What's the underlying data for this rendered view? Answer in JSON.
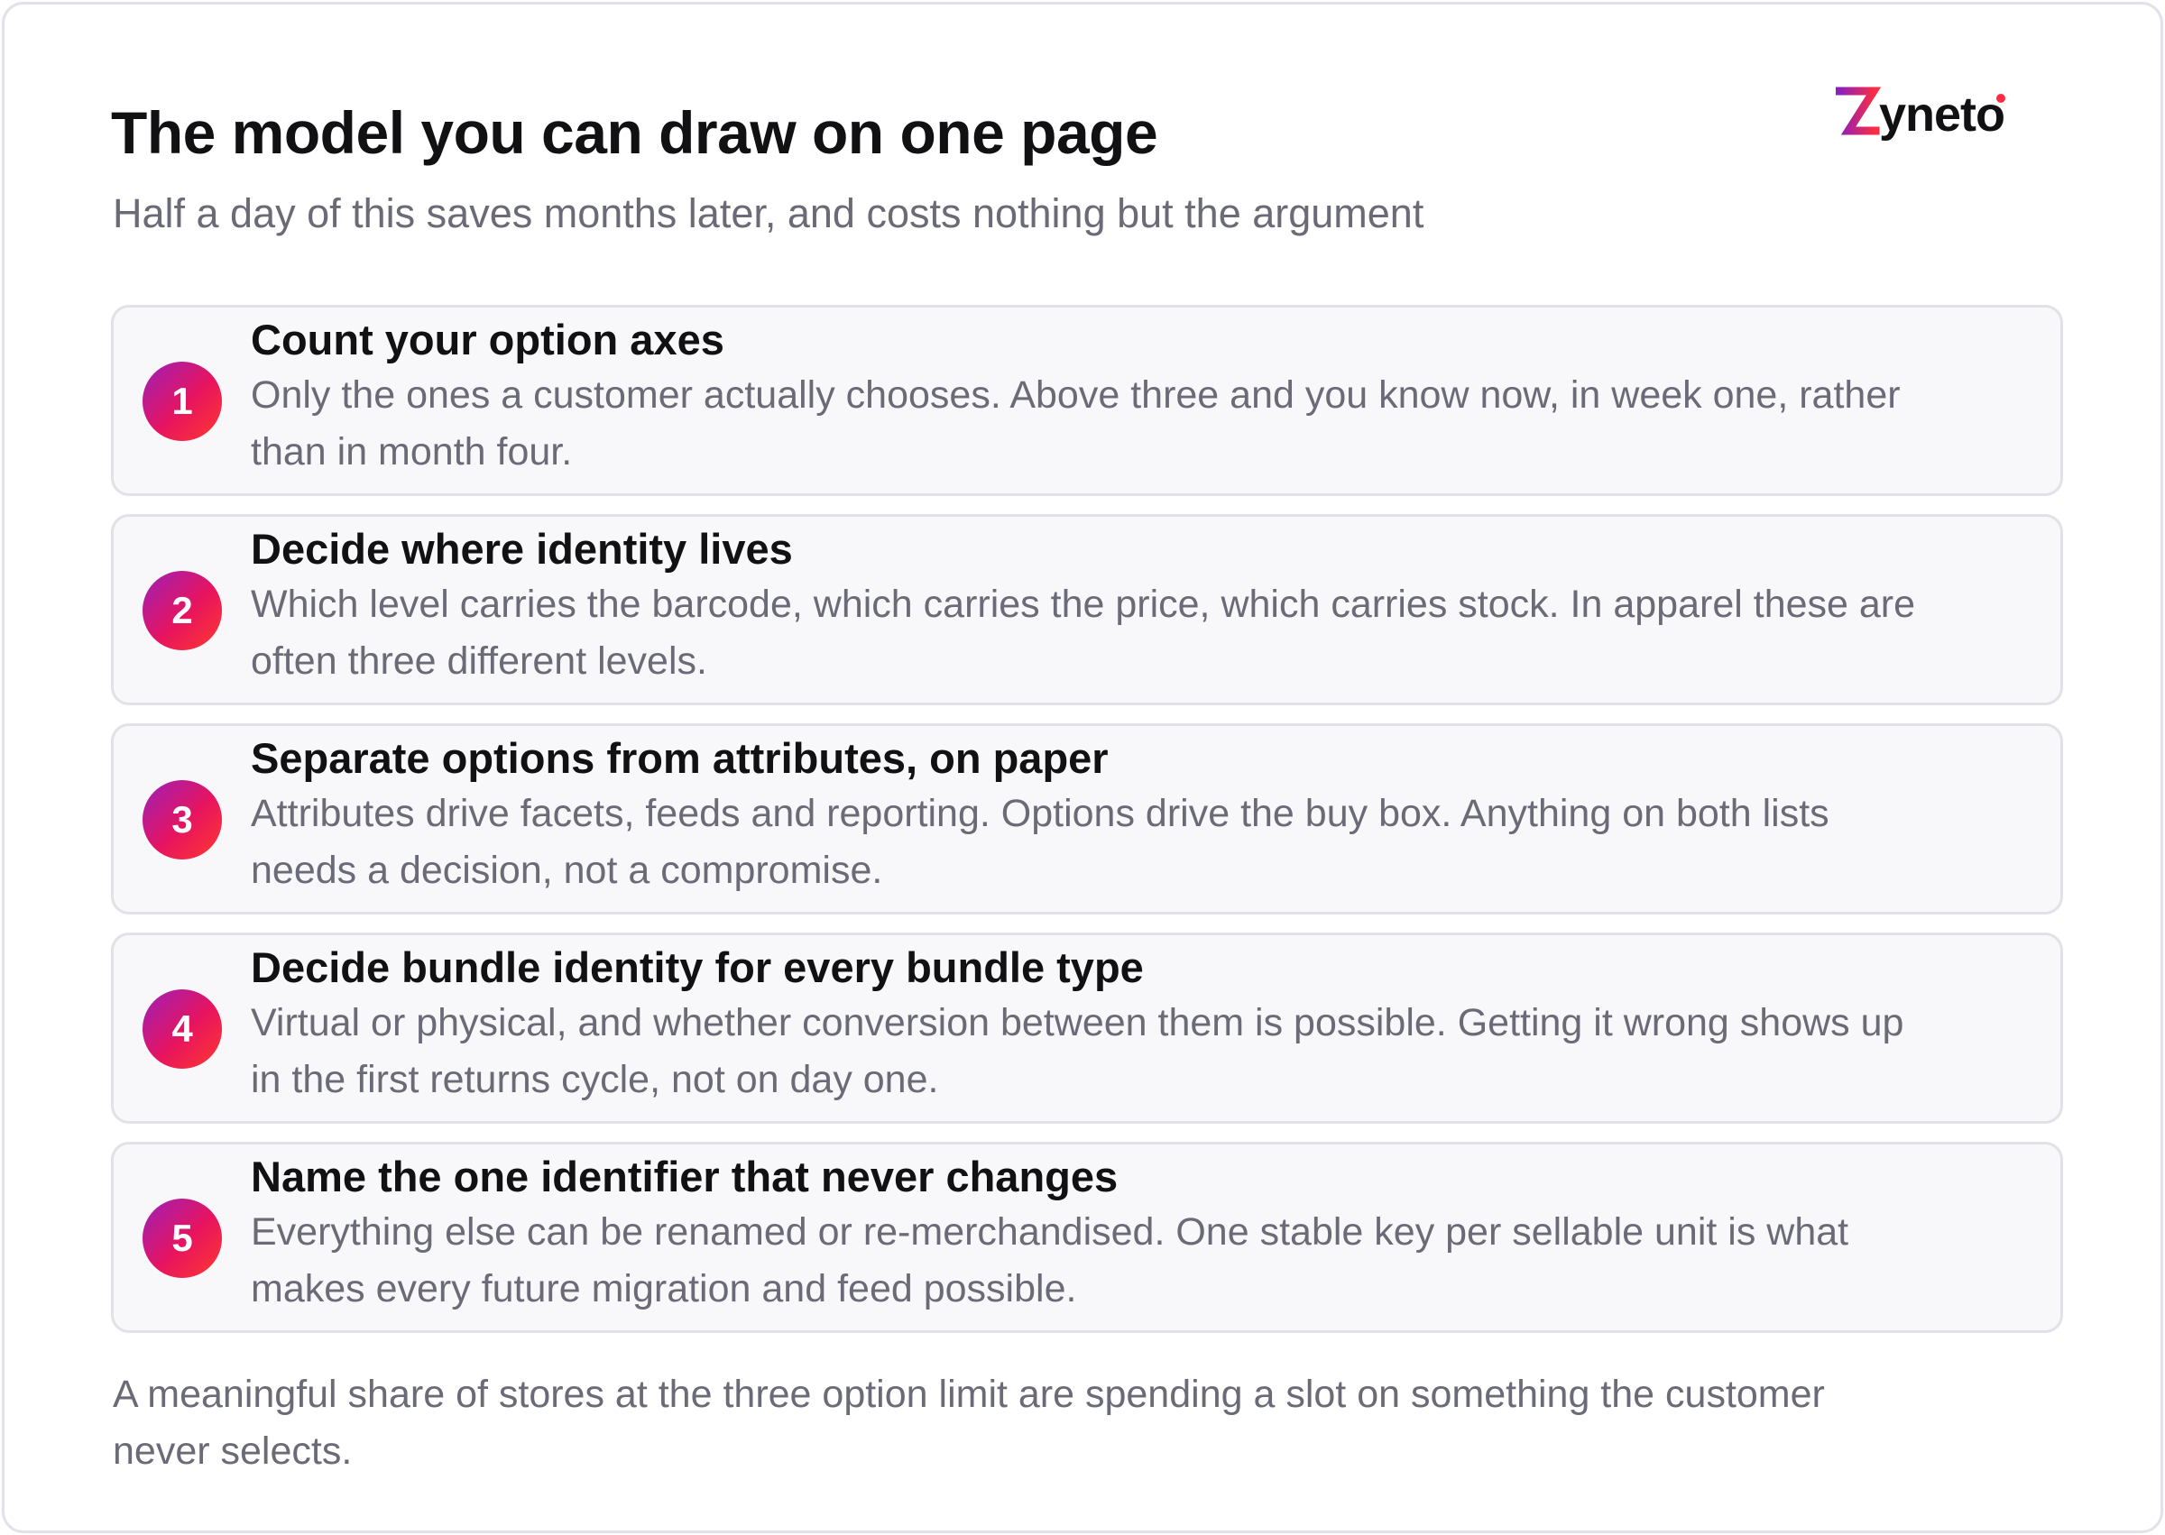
{
  "header": {
    "title": "The model you can draw on one page",
    "subtitle": "Half a day of this saves months later, and costs nothing but the argument"
  },
  "logo": {
    "text": "zyneto",
    "colors": {
      "gradient_start": "#8b1fbf",
      "gradient_end": "#ff2d3f",
      "text": "#111114"
    }
  },
  "steps": [
    {
      "number": "1",
      "title": "Count your option axes",
      "body": "Only the ones a customer actually chooses. Above three and you know now, in week one, rather than in month four."
    },
    {
      "number": "2",
      "title": "Decide where identity lives",
      "body": "Which level carries the barcode, which carries the price, which carries stock. In apparel these are often three different levels."
    },
    {
      "number": "3",
      "title": "Separate options from attributes, on paper",
      "body": "Attributes drive facets, feeds and reporting. Options drive the buy box. Anything on both lists needs a decision, not a compromise."
    },
    {
      "number": "4",
      "title": "Decide bundle identity for every bundle type",
      "body": "Virtual or physical, and whether conversion between them is possible. Getting it wrong shows up in the first returns cycle, not on day one."
    },
    {
      "number": "5",
      "title": "Name the one identifier that never changes",
      "body": "Everything else can be renamed or re-merchandised. One stable key per sellable unit is what makes every future migration and feed possible."
    }
  ],
  "footer": {
    "text": "A meaningful share of stores at the three option limit are spending a slot on something the customer never selects."
  },
  "colors": {
    "badge_gradient": [
      "#9b1fb8",
      "#e8145e",
      "#ff3a2e"
    ],
    "card_bg": "#f8f8fa",
    "card_border": "#e1e1e7",
    "title_text": "#111114",
    "body_text": "#6b6b78"
  }
}
